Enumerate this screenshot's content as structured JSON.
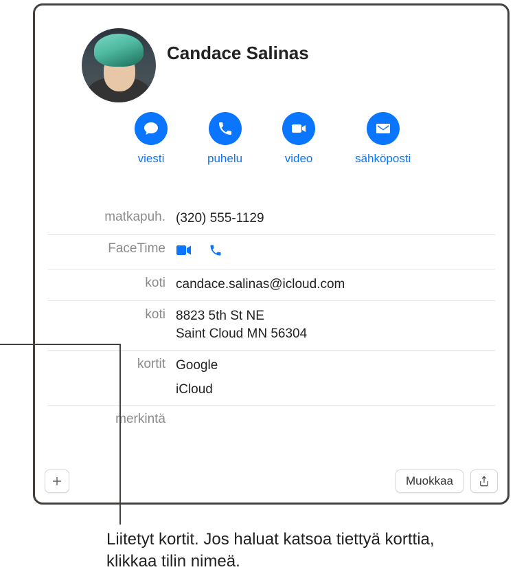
{
  "contact": {
    "name": "Candace Salinas"
  },
  "actions": {
    "message": "viesti",
    "call": "puhelu",
    "video": "video",
    "email": "sähköposti"
  },
  "fields": {
    "mobile_label": "matkapuh.",
    "mobile_value": "(320) 555-1129",
    "facetime_label": "FaceTime",
    "home_email_label": "koti",
    "home_email_value": "candace.salinas@icloud.com",
    "home_addr_label": "koti",
    "home_addr_line1": "8823 5th St NE",
    "home_addr_line2": "Saint Cloud MN 56304",
    "cards_label": "kortit",
    "cards": {
      "0": "Google",
      "1": "iCloud"
    },
    "note_label": "merkintä"
  },
  "footer": {
    "edit": "Muokkaa"
  },
  "callout": "Liitetyt kortit. Jos haluat katsoa tiettyä korttia, klikkaa tilin nimeä."
}
